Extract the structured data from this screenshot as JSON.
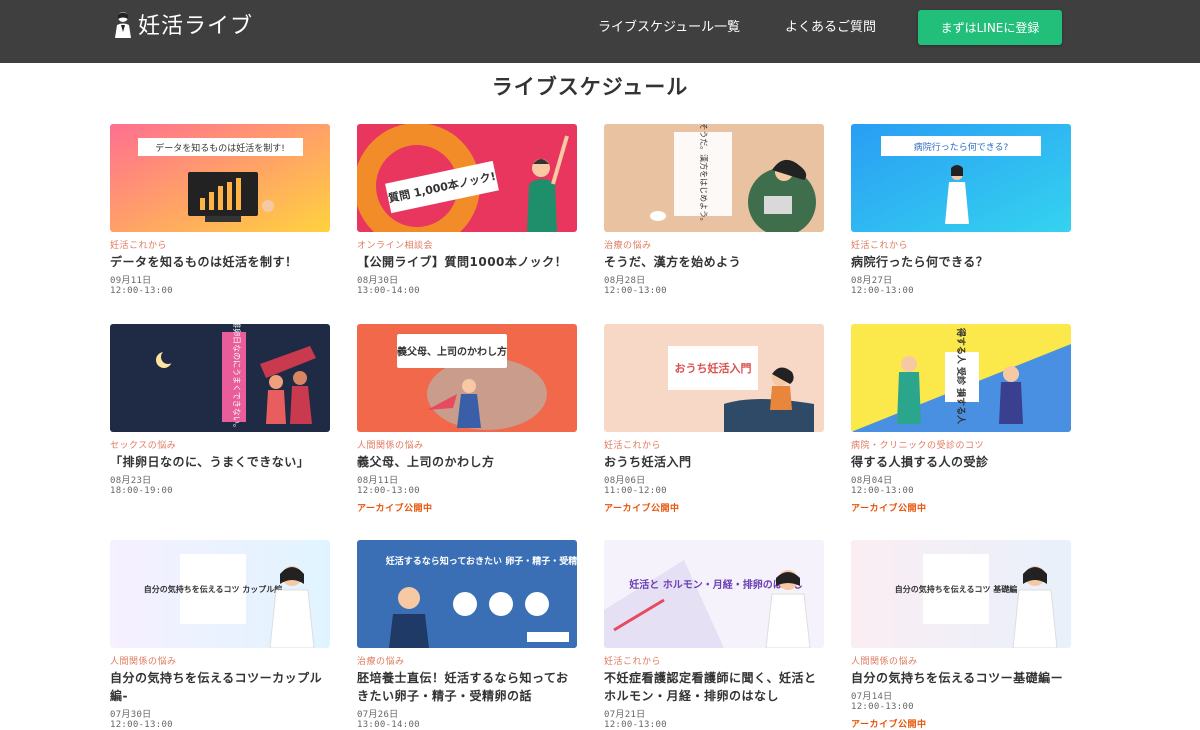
{
  "header": {
    "logo_text": "妊活ライブ",
    "nav": [
      "ライブスケジュール一覧",
      "よくあるご質問"
    ],
    "cta_label": "まずはLINEに登録"
  },
  "page_title": "ライブスケジュール",
  "cards": [
    {
      "category": "妊活これから",
      "title": "データを知るものは妊活を制す！",
      "date": "09月11日",
      "time": "12:00-13:00",
      "archive": "",
      "thumb_text": "データを知るものは妊活を制す!"
    },
    {
      "category": "オンライン相談会",
      "title": "【公開ライブ】質問1000本ノック！",
      "date": "08月30日",
      "time": "13:00-14:00",
      "archive": "",
      "thumb_text": "質問 1,000本ノック!"
    },
    {
      "category": "治療の悩み",
      "title": "そうだ、漢方を始めよう",
      "date": "08月28日",
      "time": "12:00-13:00",
      "archive": "",
      "thumb_text": "そうだ。漢方をはじめよう。"
    },
    {
      "category": "妊活これから",
      "title": "病院行ったら何できる？",
      "date": "08月27日",
      "time": "12:00-13:00",
      "archive": "",
      "thumb_text": "病院行ったら何できる?"
    },
    {
      "category": "セックスの悩み",
      "title": "「排卵日なのに、うまくできない」",
      "date": "08月23日",
      "time": "18:00-19:00",
      "archive": "",
      "thumb_text": "排卵日なのにうまくできない。"
    },
    {
      "category": "人間関係の悩み",
      "title": "義父母、上司のかわし方",
      "date": "08月11日",
      "time": "12:00-13:00",
      "archive": "アーカイブ公開中",
      "thumb_text": "義父母、上司のかわし方"
    },
    {
      "category": "妊活これから",
      "title": "おうち妊活入門",
      "date": "08月06日",
      "time": "11:00-12:00",
      "archive": "アーカイブ公開中",
      "thumb_text": "おうち妊活入門"
    },
    {
      "category": "病院・クリニックの受診のコツ",
      "title": "得する人損する人の受診",
      "date": "08月04日",
      "time": "12:00-13:00",
      "archive": "アーカイブ公開中",
      "thumb_text": "得する人 受診 損する人"
    },
    {
      "category": "人間関係の悩み",
      "title": "自分の気持ちを伝えるコツーカップル編-",
      "date": "07月30日",
      "time": "12:00-13:00",
      "archive": "",
      "thumb_text": "自分の気持ちを伝えるコツ カップル編"
    },
    {
      "category": "治療の悩み",
      "title": "胚培養士直伝！妊活するなら知っておきたい卵子・精子・受精卵の話",
      "date": "07月26日",
      "time": "13:00-14:00",
      "archive": "",
      "thumb_text": "妊活するなら知っておきたい 卵子・精子・受精卵の話"
    },
    {
      "category": "妊活これから",
      "title": "不妊症看護認定看護師に聞く、妊活とホルモン・月経・排卵のはなし",
      "date": "07月21日",
      "time": "12:00-13:00",
      "archive": "",
      "thumb_text": "妊活と ホルモン・月経・排卵のはなし"
    },
    {
      "category": "人間関係の悩み",
      "title": "自分の気持ちを伝えるコツー基礎編ー",
      "date": "07月14日",
      "time": "12:00-13:00",
      "archive": "アーカイブ公開中",
      "thumb_text": "自分の気持ちを伝えるコツ 基礎編"
    }
  ]
}
